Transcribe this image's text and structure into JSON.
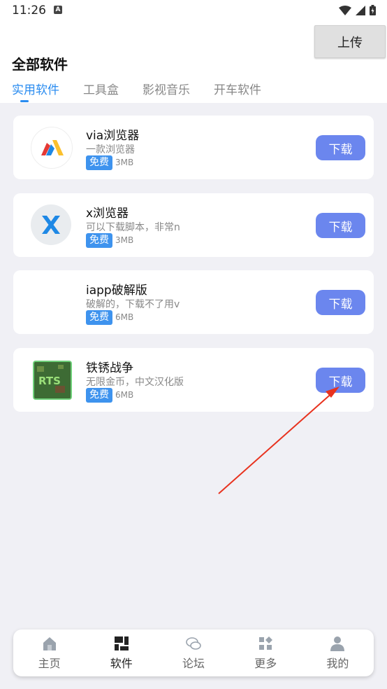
{
  "status_bar": {
    "time": "11:26",
    "notification_badge": "A"
  },
  "header": {
    "title": "全部软件",
    "upload_label": "上传",
    "tabs": [
      {
        "label": "实用软件",
        "active": true
      },
      {
        "label": "工具盒",
        "active": false
      },
      {
        "label": "影视音乐",
        "active": false
      },
      {
        "label": "开车软件",
        "active": false
      }
    ]
  },
  "apps": [
    {
      "name": "via浏览器",
      "desc": "一款浏览器",
      "badge": "免费",
      "size": "3MB",
      "download_label": "下载",
      "icon": "via-logo-icon"
    },
    {
      "name": "x浏览器",
      "desc": "可以下载脚本，非常n",
      "badge": "免费",
      "size": "3MB",
      "download_label": "下载",
      "icon": "x-browser-logo-icon"
    },
    {
      "name": "iapp破解版",
      "desc": "破解的，下载不了用v",
      "badge": "免费",
      "size": "6MB",
      "download_label": "下载",
      "icon": "blank-icon"
    },
    {
      "name": "铁锈战争",
      "desc": "无限金币，中文汉化版",
      "badge": "免费",
      "size": "6MB",
      "download_label": "下载",
      "icon": "rts-game-icon"
    }
  ],
  "nav": [
    {
      "label": "主页",
      "icon": "home-icon",
      "active": false
    },
    {
      "label": "软件",
      "icon": "apps-grid-icon",
      "active": true
    },
    {
      "label": "论坛",
      "icon": "chat-bubbles-icon",
      "active": false
    },
    {
      "label": "更多",
      "icon": "more-blocks-icon",
      "active": false
    },
    {
      "label": "我的",
      "icon": "user-icon",
      "active": false
    }
  ],
  "colors": {
    "accent": "#2a8cf0",
    "download_button": "#6b86ee",
    "badge": "#3e93ee",
    "annotation_arrow": "#e8321e"
  }
}
